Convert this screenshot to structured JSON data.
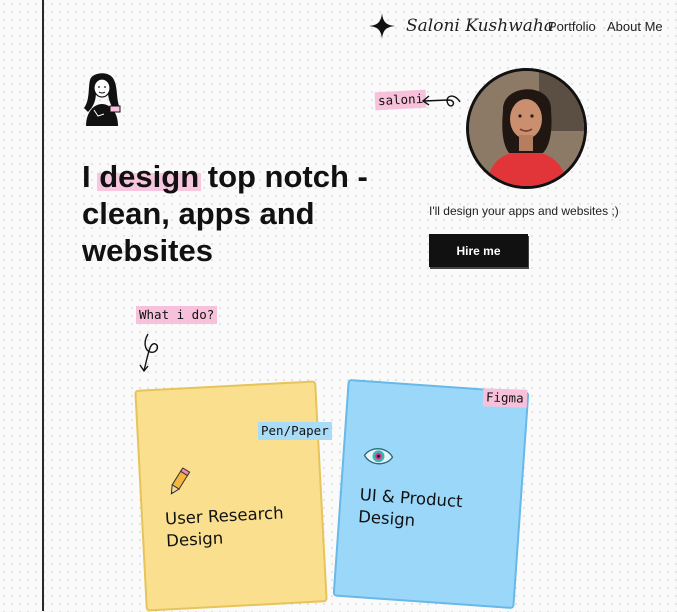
{
  "brand": {
    "name": "Saloni Kushwaha",
    "logo_icon": "sparkle-star-icon"
  },
  "nav": {
    "items": [
      {
        "label": "Portfolio"
      },
      {
        "label": "About Me"
      }
    ]
  },
  "hero": {
    "title_highlight": "design",
    "title_prefix": "I ",
    "title_rest": " top notch - clean, apps and websites",
    "intro": "I'll design your apps and websites ;)",
    "cta_label": "Hire me"
  },
  "tags": {
    "name": "saloni",
    "what_i_do": "What i do?",
    "pen_paper": "Pen/Paper",
    "figma": "Figma"
  },
  "services": [
    {
      "title": "User Research Design",
      "icon": "pencil-icon",
      "color": "#f9df8e"
    },
    {
      "title": "UI & Product Design",
      "icon": "eye-icon",
      "color": "#9bd7f9"
    }
  ],
  "colors": {
    "highlight_pink": "#f7c1dc",
    "highlight_blue": "#a9dcf7",
    "button_bg": "#111111"
  }
}
